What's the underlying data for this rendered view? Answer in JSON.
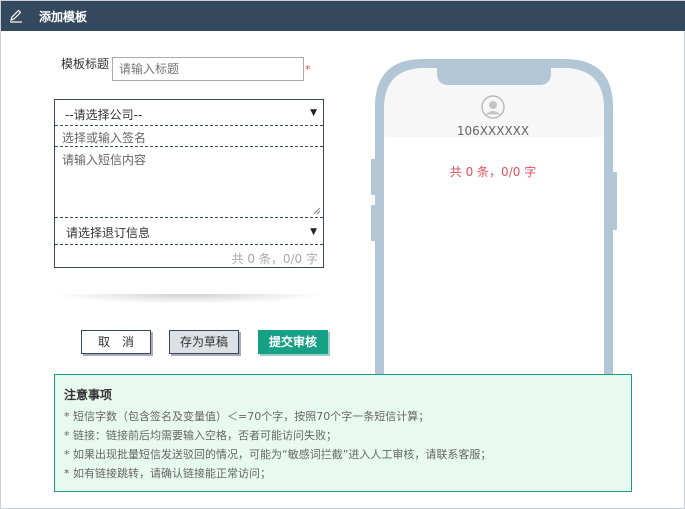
{
  "header": {
    "title": "添加模板",
    "icon": "edit-icon"
  },
  "form": {
    "title_label": "模板标题",
    "title_placeholder": "请输入标题",
    "required_mark": "*",
    "company_select": "--请选择公司--",
    "sign_placeholder": "选择或输入签名",
    "content_placeholder": "请输入短信内容",
    "unsubscribe_select": "请选择退订信息",
    "counter": "共 0 条，0/0 字"
  },
  "buttons": {
    "cancel": "取　消",
    "draft": "存为草稿",
    "submit": "提交审核"
  },
  "preview": {
    "sender": "106XXXXXX",
    "counter": "共 0 条，0/0 字"
  },
  "notice": {
    "title": "注意事项",
    "items": [
      "* 短信字数（包含签名及变量值）＜=70个字，按照70个字一条短信计算；",
      "* 链接：链接前后均需要输入空格，否者可能访问失败；",
      "* 如果出现批量短信发送驳回的情况，可能为“敏感词拦截”进入人工审核，请联系客服；",
      "* 如有链接跳转，请确认链接能正常访问；"
    ]
  },
  "colors": {
    "header_bg": "#34495e",
    "accent": "#16a085",
    "notice_bg": "#e8faf0",
    "phone_frame": "#b3c6d6",
    "counter_red": "#e05260"
  }
}
